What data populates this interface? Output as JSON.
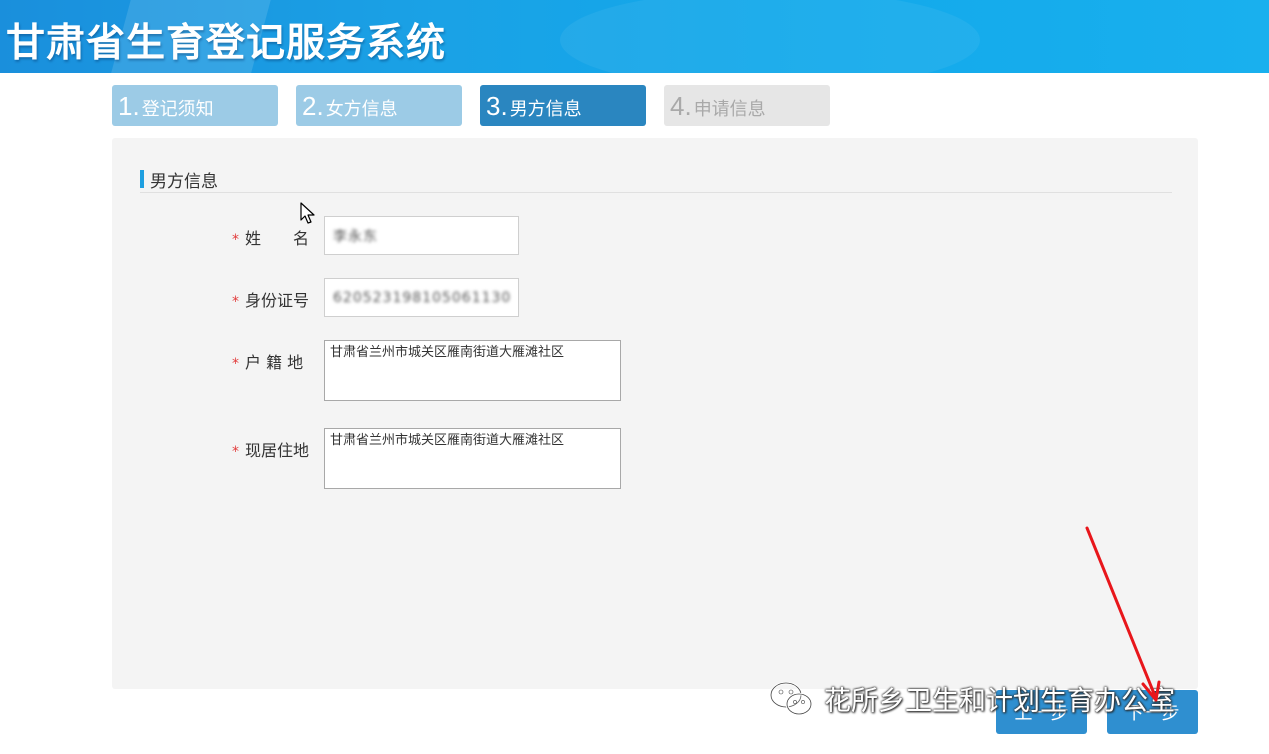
{
  "header": {
    "title": "甘肃省生育登记服务系统"
  },
  "steps": [
    {
      "num": "1.",
      "label": "登记须知",
      "state": "done"
    },
    {
      "num": "2.",
      "label": "女方信息",
      "state": "done"
    },
    {
      "num": "3.",
      "label": "男方信息",
      "state": "active"
    },
    {
      "num": "4.",
      "label": "申请信息",
      "state": "pending"
    }
  ],
  "section": {
    "title": "男方信息"
  },
  "form": {
    "required_mark": "*",
    "name": {
      "label": "姓　　名",
      "value": "李永东"
    },
    "id_number": {
      "label": "身份证号",
      "value": "620523198105061130"
    },
    "household": {
      "label": "户 籍 地",
      "value": "甘肃省兰州市城关区雁南街道大雁滩社区"
    },
    "residence": {
      "label": "现居住地",
      "value": "甘肃省兰州市城关区雁南街道大雁滩社区"
    }
  },
  "buttons": {
    "prev": "上一步",
    "next": "下一步"
  },
  "watermark": {
    "text": "花所乡卫生和计划生育办公室",
    "icon": "wechat-icon"
  },
  "colors": {
    "header_blue": "#1aa2e6",
    "step_done": "#9ccbe6",
    "step_active": "#2a86c0",
    "step_pending": "#e6e6e6",
    "button": "#2f8fd0",
    "required_star": "#e23b3b",
    "annotation_arrow": "#e8161b"
  }
}
